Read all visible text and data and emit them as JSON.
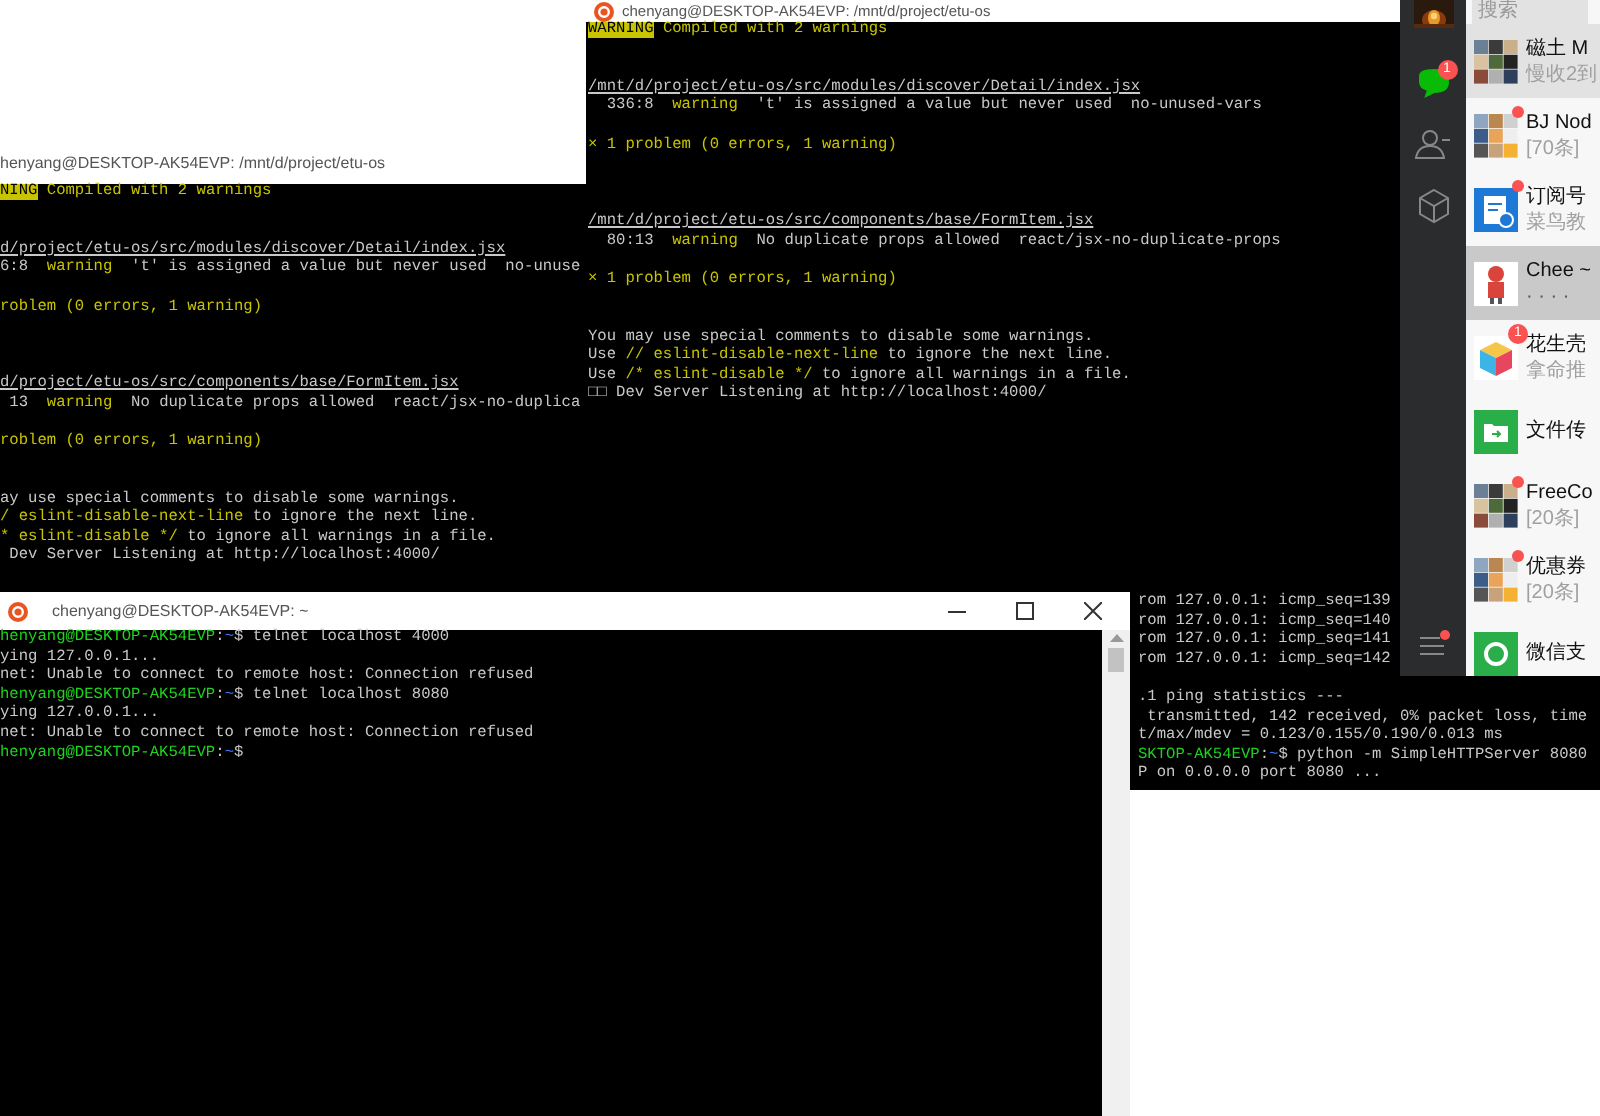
{
  "windows": [
    {
      "kind": "terminal",
      "scrollbar": false,
      "lines": [
        {
          "spans": [
            {
              "kind": "plain",
              "text": "rom 127.0.0.1: icmp_seq=139"
            }
          ]
        },
        {
          "spans": [
            {
              "kind": "plain",
              "text": "rom 127.0.0.1: icmp_seq=140"
            }
          ]
        },
        {
          "spans": [
            {
              "kind": "plain",
              "text": "rom 127.0.0.1: icmp_seq=141"
            }
          ]
        },
        {
          "spans": [
            {
              "kind": "plain",
              "text": "rom 127.0.0.1: icmp_seq=142"
            }
          ]
        },
        {
          "spans": [
            {
              "kind": "plain",
              "text": ".1 ping statistics ---"
            }
          ]
        },
        {
          "spans": [
            {
              "kind": "plain",
              "text": " transmitted, 142 received, 0% packet loss, time"
            }
          ]
        },
        {
          "spans": [
            {
              "kind": "plain",
              "text": "t/max/mdev = 0.123/0.155/0.190/0.013 ms"
            }
          ]
        },
        {
          "spans": [
            {
              "kind": "user",
              "text": "SKTOP-AK54EVP"
            },
            {
              "kind": "plain",
              "text": ":"
            },
            {
              "kind": "tilde",
              "text": "~"
            },
            {
              "kind": "plain",
              "text": "$ python -m SimpleHTTPServer 8080"
            }
          ]
        },
        {
          "spans": [
            {
              "kind": "plain",
              "text": "P on 0.0.0.0 port 8080 ..."
            }
          ]
        }
      ]
    },
    {
      "kind": "terminal",
      "title": "henyang@DESKTOP-AK54EVP: /mnt/d/project/etu-os",
      "scrollbar": false,
      "lines": [
        {
          "spans": [
            {
              "kind": "badge",
              "text": "NING"
            },
            {
              "kind": "yellow",
              "text": " Compiled with 2 warnings"
            }
          ]
        },
        {
          "spans": [
            {
              "kind": "path",
              "text": "d/project/etu-os/src/modules/discover/Detail/index.jsx"
            }
          ]
        },
        {
          "spans": [
            {
              "kind": "plain",
              "text": "6:8  "
            },
            {
              "kind": "yellow",
              "text": "warning"
            },
            {
              "kind": "plain",
              "text": "  't' is assigned a value but never used  no-unuse"
            }
          ]
        },
        {
          "spans": [
            {
              "kind": "yellow",
              "text": "roblem (0 errors, 1 warning)"
            }
          ]
        },
        {
          "spans": [
            {
              "kind": "path",
              "text": "d/project/etu-os/src/components/base/FormItem.jsx"
            }
          ]
        },
        {
          "spans": [
            {
              "kind": "plain",
              "text": " 13  "
            },
            {
              "kind": "yellow",
              "text": "warning"
            },
            {
              "kind": "plain",
              "text": "  No duplicate props allowed  react/jsx-no-duplica"
            }
          ]
        },
        {
          "spans": [
            {
              "kind": "yellow",
              "text": "roblem (0 errors, 1 warning)"
            }
          ]
        },
        {
          "spans": [
            {
              "kind": "plain",
              "text": "ay use special comments to disable some warnings."
            }
          ]
        },
        {
          "spans": [
            {
              "kind": "yellow",
              "text": "/ eslint-disable-next-line"
            },
            {
              "kind": "plain",
              "text": " to ignore the next line."
            }
          ]
        },
        {
          "spans": [
            {
              "kind": "yellow",
              "text": "* eslint-disable */"
            },
            {
              "kind": "plain",
              "text": " to ignore all warnings in a file."
            }
          ]
        },
        {
          "spans": [
            {
              "kind": "plain",
              "text": " Dev Server Listening at http://localhost:4000/"
            }
          ]
        }
      ]
    },
    {
      "kind": "terminal",
      "title": "chenyang@DESKTOP-AK54EVP: /mnt/d/project/etu-os",
      "scrollbar": false,
      "lines": [
        {
          "spans": [
            {
              "kind": "badge",
              "text": "WARNING"
            },
            {
              "kind": "yellow",
              "text": " Compiled with 2 warnings"
            }
          ]
        },
        {
          "spans": [
            {
              "kind": "path",
              "text": "/mnt/d/project/etu-os/src/modules/discover/Detail/index.jsx"
            }
          ]
        },
        {
          "spans": [
            {
              "kind": "plain",
              "text": "  336:8  "
            },
            {
              "kind": "yellow",
              "text": "warning"
            },
            {
              "kind": "plain",
              "text": "  't' is assigned a value but never used  no-unused-vars"
            }
          ]
        },
        {
          "spans": [
            {
              "kind": "yellow",
              "text": "× 1 problem (0 errors, 1 warning)"
            }
          ]
        },
        {
          "spans": [
            {
              "kind": "path",
              "text": "/mnt/d/project/etu-os/src/components/base/FormItem.jsx"
            }
          ]
        },
        {
          "spans": [
            {
              "kind": "plain",
              "text": "  80:13  "
            },
            {
              "kind": "yellow",
              "text": "warning"
            },
            {
              "kind": "plain",
              "text": "  No duplicate props allowed  react/jsx-no-duplicate-props"
            }
          ]
        },
        {
          "spans": [
            {
              "kind": "yellow",
              "text": "× 1 problem (0 errors, 1 warning)"
            }
          ]
        },
        {
          "spans": [
            {
              "kind": "plain",
              "text": "You may use special comments to disable some warnings."
            }
          ]
        },
        {
          "spans": [
            {
              "kind": "plain",
              "text": "Use "
            },
            {
              "kind": "yellow",
              "text": "// eslint-disable-next-line"
            },
            {
              "kind": "plain",
              "text": " to ignore the next line."
            }
          ]
        },
        {
          "spans": [
            {
              "kind": "plain",
              "text": "Use "
            },
            {
              "kind": "yellow",
              "text": "/* eslint-disable */"
            },
            {
              "kind": "plain",
              "text": " to ignore all warnings in a file."
            }
          ]
        },
        {
          "spans": [
            {
              "kind": "plain",
              "text": "□□ Dev Server Listening at http://localhost:4000/"
            }
          ]
        }
      ]
    },
    {
      "kind": "terminal",
      "title": "chenyang@DESKTOP-AK54EVP: ~",
      "scrollbar": true,
      "window_buttons": [
        {
          "kind": "minimize"
        },
        {
          "kind": "maximize"
        },
        {
          "kind": "close"
        }
      ],
      "lines": [
        {
          "spans": [
            {
              "kind": "user",
              "text": "henyang@DESKTOP-AK54EVP"
            },
            {
              "kind": "plain",
              "text": ":"
            },
            {
              "kind": "tilde",
              "text": "~"
            },
            {
              "kind": "plain",
              "text": "$ telnet localhost 4000"
            }
          ]
        },
        {
          "spans": [
            {
              "kind": "plain",
              "text": "ying 127.0.0.1..."
            }
          ]
        },
        {
          "spans": [
            {
              "kind": "plain",
              "text": "net: Unable to connect to remote host: Connection refused"
            }
          ]
        },
        {
          "spans": [
            {
              "kind": "user",
              "text": "henyang@DESKTOP-AK54EVP"
            },
            {
              "kind": "plain",
              "text": ":"
            },
            {
              "kind": "tilde",
              "text": "~"
            },
            {
              "kind": "plain",
              "text": "$ telnet localhost 8080"
            }
          ]
        },
        {
          "spans": [
            {
              "kind": "plain",
              "text": "ying 127.0.0.1..."
            }
          ]
        },
        {
          "spans": [
            {
              "kind": "plain",
              "text": "net: Unable to connect to remote host: Connection refused"
            }
          ]
        },
        {
          "spans": [
            {
              "kind": "user",
              "text": "henyang@DESKTOP-AK54EVP"
            },
            {
              "kind": "plain",
              "text": ":"
            },
            {
              "kind": "tilde",
              "text": "~"
            },
            {
              "kind": "plain",
              "text": "$"
            }
          ]
        }
      ]
    }
  ],
  "chat_app": {
    "sidebar": {
      "nav": [
        {
          "kind": "chats",
          "selected": true,
          "badge": "1"
        },
        {
          "kind": "contacts",
          "selected": false
        },
        {
          "kind": "favorites",
          "selected": false
        }
      ],
      "menu": {
        "dot": true
      }
    },
    "search": {
      "placeholder": "搜索"
    },
    "chats": [
      {
        "kind": "group",
        "name": "磁土 M",
        "preview": "慢收2到",
        "pinned": true,
        "selected": false,
        "unread_dot": false
      },
      {
        "kind": "group",
        "name": "BJ Nod",
        "preview": "[70条]",
        "pinned": false,
        "selected": false,
        "unread_dot": true
      },
      {
        "kind": "document",
        "name": "订阅号",
        "preview": "菜鸟教",
        "pinned": false,
        "selected": false,
        "unread_dot": true
      },
      {
        "kind": "figure",
        "name": "Chee ~",
        "preview": "· · · ·",
        "pinned": false,
        "selected": true,
        "unread_dot": false
      },
      {
        "kind": "cube",
        "name": "花生壳",
        "preview": "拿命推",
        "pinned": false,
        "selected": false,
        "unread_dot": false,
        "unread_count": "1"
      },
      {
        "kind": "folder",
        "name": "文件传",
        "pinned": false,
        "selected": false,
        "unread_dot": false
      },
      {
        "kind": "group",
        "name": "FreeCo",
        "preview": "[20条]",
        "pinned": false,
        "selected": false,
        "unread_dot": true
      },
      {
        "kind": "group",
        "name": "优惠券",
        "preview": "[20条]",
        "pinned": false,
        "selected": false,
        "unread_dot": true
      },
      {
        "kind": "payment",
        "name": "微信支",
        "pinned": false,
        "selected": false,
        "unread_dot": false
      }
    ]
  }
}
